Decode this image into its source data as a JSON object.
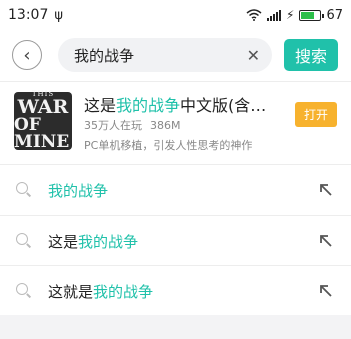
{
  "status_bar": {
    "time": "13:07",
    "usb_icon": "ψ",
    "battery_level": "67",
    "battery_color": "#2cbf4a"
  },
  "search": {
    "back_icon": "‹",
    "query": "我的战争",
    "clear_icon": "✕",
    "button_label": "搜索",
    "accent": "#20c1aa"
  },
  "game": {
    "logo_lines": [
      "THIS",
      "WAR",
      "OF MINE"
    ],
    "title_prefix": "这是",
    "title_highlight": "我的战争",
    "title_suffix": "中文版(含数..",
    "players": "35万人在玩",
    "size": "386M",
    "description": "PC单机移植，引发人性思考的神作",
    "open_label": "打开",
    "open_color": "#f7b22e"
  },
  "suggestions": [
    {
      "prefix": "",
      "highlight": "我的战争",
      "suffix": ""
    },
    {
      "prefix": "这是",
      "highlight": "我的战争",
      "suffix": ""
    },
    {
      "prefix": "这就是",
      "highlight": "我的战争",
      "suffix": ""
    }
  ],
  "icons": {
    "suggestion_icon": "search-icon",
    "fill_arrow_icon": "arrow-up-left-icon"
  }
}
